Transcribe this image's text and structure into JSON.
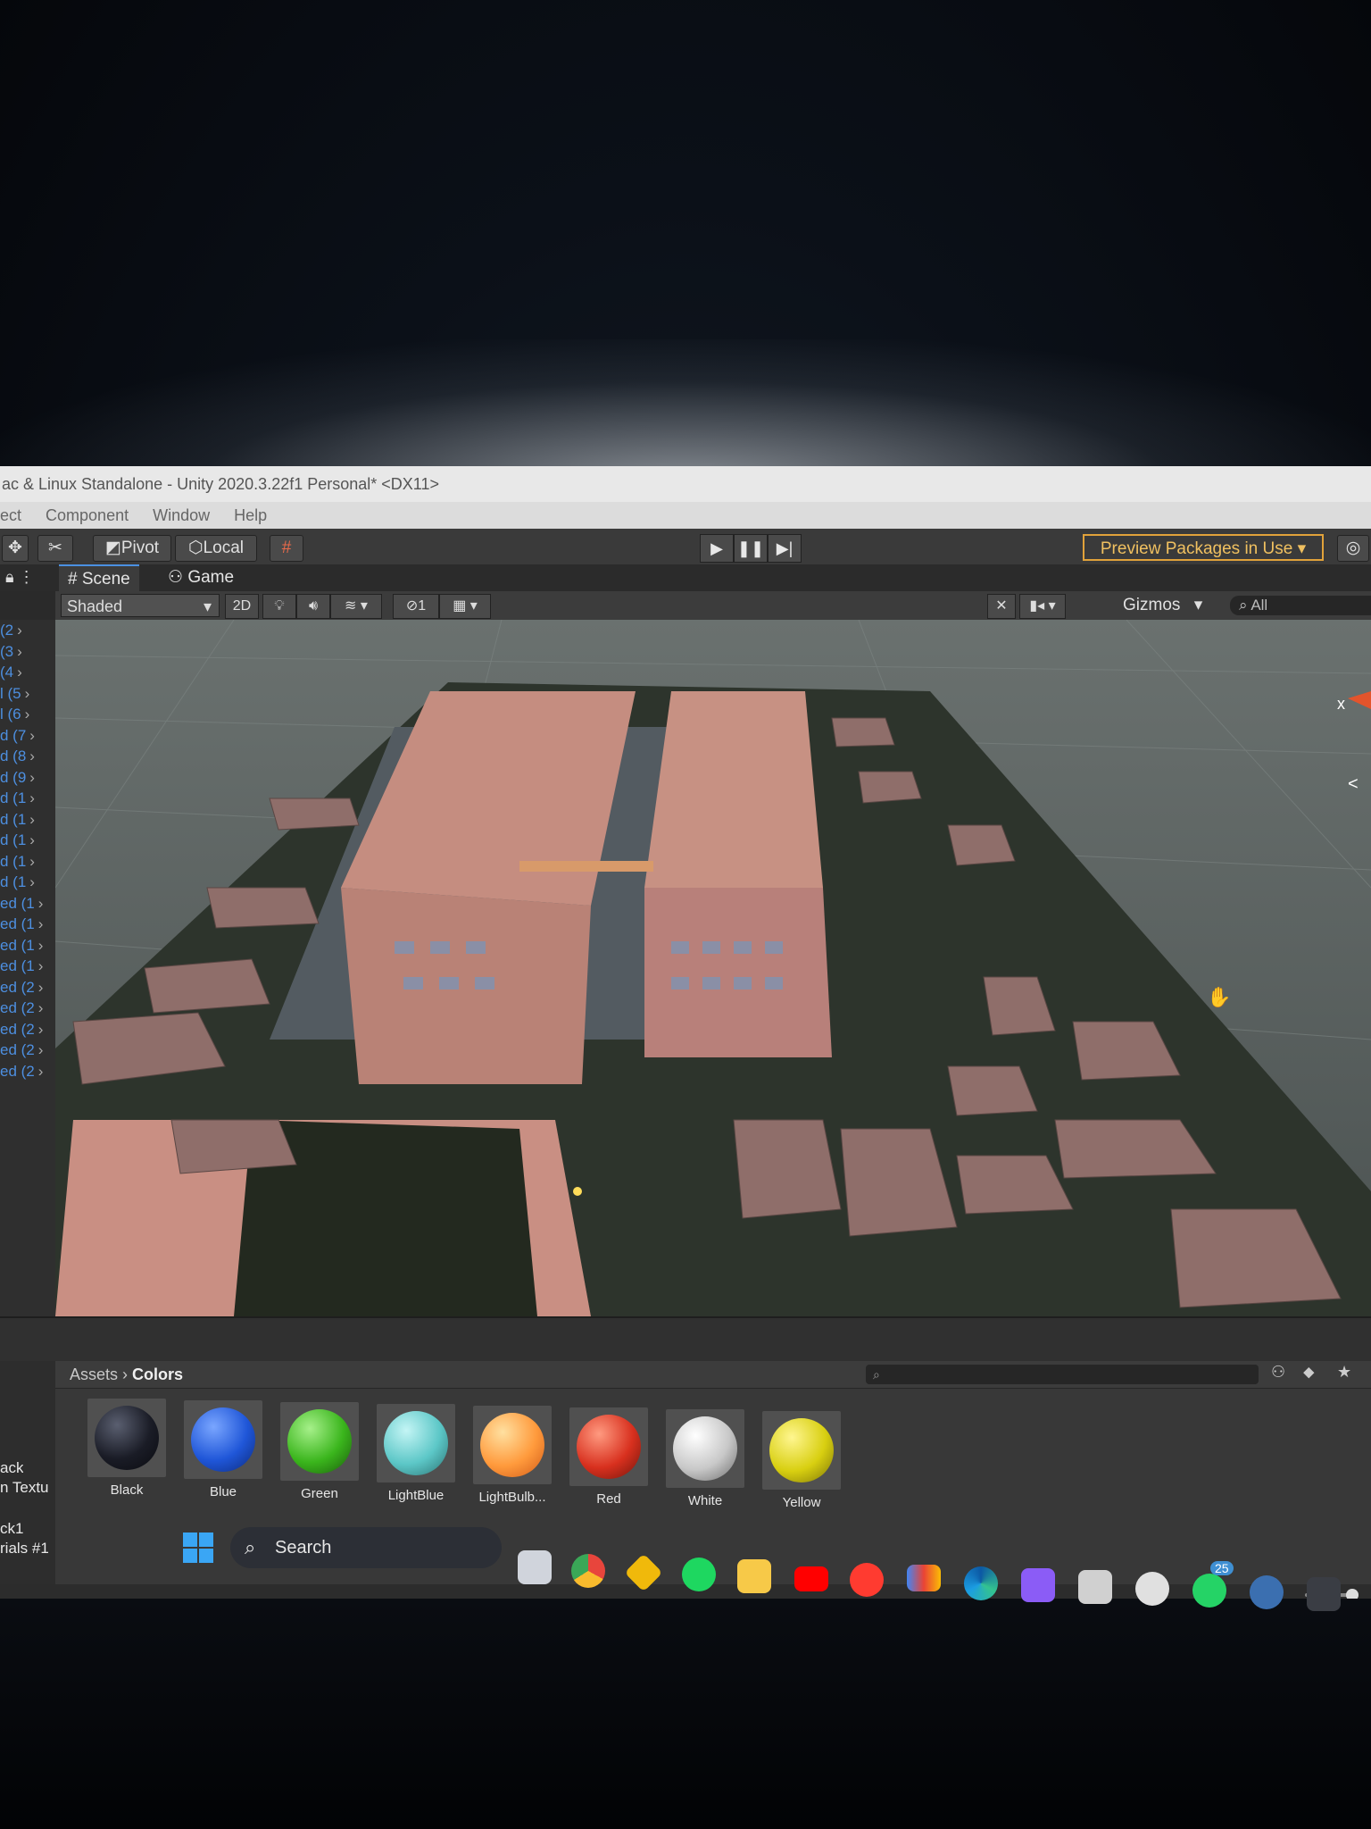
{
  "window": {
    "title": "ac & Linux Standalone - Unity 2020.3.22f1 Personal* <DX11>",
    "menu": [
      "ect",
      "Component",
      "Window",
      "Help"
    ]
  },
  "toolbar": {
    "pivot": "Pivot",
    "local": "Local",
    "preview_packages": "Preview Packages in Use ▾"
  },
  "tabs": [
    {
      "label": "Scene",
      "active": true
    },
    {
      "label": "Game",
      "active": false
    }
  ],
  "scene_options": {
    "shading_mode": "Shaded",
    "mode_2d": "2D",
    "hidden_count": "1",
    "gizmos": "Gizmos",
    "search_placeholder": "All"
  },
  "hierarchy": {
    "rows": [
      "(2",
      "(3",
      "(4",
      "l (5",
      "l (6",
      "d (7",
      "d (8",
      "d (9",
      "d (1",
      "d (1",
      "d (1",
      "d (1",
      "d (1",
      "ed (1",
      "ed (1",
      "ed (1",
      "ed (1",
      "ed (2",
      "ed (2",
      "ed (2",
      "ed (2",
      "ed (2"
    ]
  },
  "project": {
    "breadcrumb_root": "Assets",
    "breadcrumb_current": "Colors",
    "left_items": [
      "ack",
      "n Textu",
      "ck1",
      "rials #1"
    ],
    "assets": [
      {
        "label": "Black",
        "color": "#1a1c26"
      },
      {
        "label": "Blue",
        "color": "#1f56d8"
      },
      {
        "label": "Green",
        "color": "#3ab51c"
      },
      {
        "label": "LightBlue",
        "color": "#5cc7c7"
      },
      {
        "label": "LightBulb...",
        "color": "#ff9a3c"
      },
      {
        "label": "Red",
        "color": "#d8301e"
      },
      {
        "label": "White",
        "color": "#c8c8c8"
      },
      {
        "label": "Yellow",
        "color": "#d8cf10"
      }
    ]
  },
  "taskbar": {
    "search_label": "Search",
    "whatsapp_badge": "25",
    "icons": [
      "task-view",
      "chrome",
      "binance",
      "spotify",
      "file-explorer",
      "youtube",
      "youtube-music",
      "gmail",
      "edge",
      "visual-studio",
      "unity-hub",
      "settings",
      "whatsapp",
      "steam",
      "unity"
    ]
  }
}
